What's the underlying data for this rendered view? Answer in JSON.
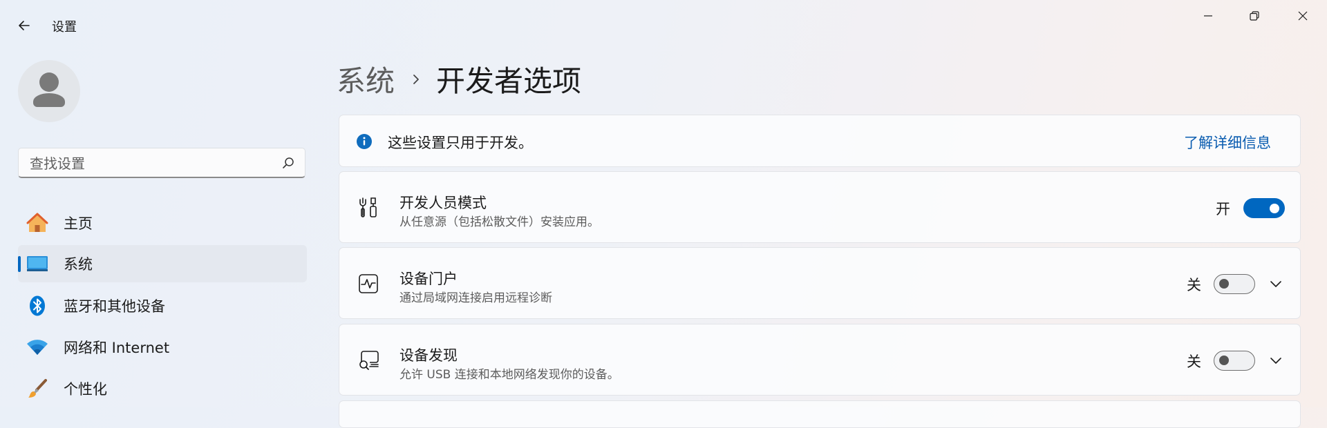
{
  "window": {
    "title": "设置",
    "controls": [
      "minimize",
      "restore",
      "close"
    ]
  },
  "sidebar": {
    "search": {
      "placeholder": "查找设置",
      "value": ""
    },
    "items": [
      {
        "label": "主页",
        "icon": "home-icon",
        "active": false
      },
      {
        "label": "系统",
        "icon": "system-icon",
        "active": true
      },
      {
        "label": "蓝牙和其他设备",
        "icon": "bluetooth-icon",
        "active": false
      },
      {
        "label": "网络和 Internet",
        "icon": "wifi-icon",
        "active": false
      },
      {
        "label": "个性化",
        "icon": "brush-icon",
        "active": false
      }
    ]
  },
  "main": {
    "breadcrumb": {
      "parent": "系统",
      "current": "开发者选项"
    },
    "info_banner": {
      "text": "这些设置只用于开发。",
      "link": "了解详细信息"
    },
    "settings": [
      {
        "title": "开发人员模式",
        "description": "从任意源（包括松散文件）安装应用。",
        "state_label": "开",
        "on": true,
        "expandable": false,
        "icon": "developer-tools-icon"
      },
      {
        "title": "设备门户",
        "description": "通过局域网连接启用远程诊断",
        "state_label": "关",
        "on": false,
        "expandable": true,
        "icon": "device-portal-icon"
      },
      {
        "title": "设备发现",
        "description": "允许 USB 连接和本地网络发现你的设备。",
        "state_label": "关",
        "on": false,
        "expandable": true,
        "icon": "device-discovery-icon"
      }
    ]
  },
  "colors": {
    "accent": "#0067c0",
    "link": "#0a5cb0",
    "info_icon": "#0f6cbd"
  }
}
